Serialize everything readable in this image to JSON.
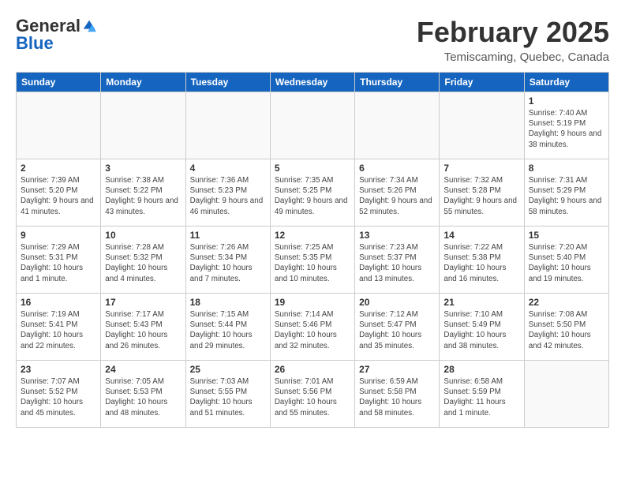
{
  "logo": {
    "general": "General",
    "blue": "Blue"
  },
  "header": {
    "month": "February 2025",
    "location": "Temiscaming, Quebec, Canada"
  },
  "weekdays": [
    "Sunday",
    "Monday",
    "Tuesday",
    "Wednesday",
    "Thursday",
    "Friday",
    "Saturday"
  ],
  "weeks": [
    [
      {
        "day": "",
        "info": ""
      },
      {
        "day": "",
        "info": ""
      },
      {
        "day": "",
        "info": ""
      },
      {
        "day": "",
        "info": ""
      },
      {
        "day": "",
        "info": ""
      },
      {
        "day": "",
        "info": ""
      },
      {
        "day": "1",
        "info": "Sunrise: 7:40 AM\nSunset: 5:19 PM\nDaylight: 9 hours and 38 minutes."
      }
    ],
    [
      {
        "day": "2",
        "info": "Sunrise: 7:39 AM\nSunset: 5:20 PM\nDaylight: 9 hours and 41 minutes."
      },
      {
        "day": "3",
        "info": "Sunrise: 7:38 AM\nSunset: 5:22 PM\nDaylight: 9 hours and 43 minutes."
      },
      {
        "day": "4",
        "info": "Sunrise: 7:36 AM\nSunset: 5:23 PM\nDaylight: 9 hours and 46 minutes."
      },
      {
        "day": "5",
        "info": "Sunrise: 7:35 AM\nSunset: 5:25 PM\nDaylight: 9 hours and 49 minutes."
      },
      {
        "day": "6",
        "info": "Sunrise: 7:34 AM\nSunset: 5:26 PM\nDaylight: 9 hours and 52 minutes."
      },
      {
        "day": "7",
        "info": "Sunrise: 7:32 AM\nSunset: 5:28 PM\nDaylight: 9 hours and 55 minutes."
      },
      {
        "day": "8",
        "info": "Sunrise: 7:31 AM\nSunset: 5:29 PM\nDaylight: 9 hours and 58 minutes."
      }
    ],
    [
      {
        "day": "9",
        "info": "Sunrise: 7:29 AM\nSunset: 5:31 PM\nDaylight: 10 hours and 1 minute."
      },
      {
        "day": "10",
        "info": "Sunrise: 7:28 AM\nSunset: 5:32 PM\nDaylight: 10 hours and 4 minutes."
      },
      {
        "day": "11",
        "info": "Sunrise: 7:26 AM\nSunset: 5:34 PM\nDaylight: 10 hours and 7 minutes."
      },
      {
        "day": "12",
        "info": "Sunrise: 7:25 AM\nSunset: 5:35 PM\nDaylight: 10 hours and 10 minutes."
      },
      {
        "day": "13",
        "info": "Sunrise: 7:23 AM\nSunset: 5:37 PM\nDaylight: 10 hours and 13 minutes."
      },
      {
        "day": "14",
        "info": "Sunrise: 7:22 AM\nSunset: 5:38 PM\nDaylight: 10 hours and 16 minutes."
      },
      {
        "day": "15",
        "info": "Sunrise: 7:20 AM\nSunset: 5:40 PM\nDaylight: 10 hours and 19 minutes."
      }
    ],
    [
      {
        "day": "16",
        "info": "Sunrise: 7:19 AM\nSunset: 5:41 PM\nDaylight: 10 hours and 22 minutes."
      },
      {
        "day": "17",
        "info": "Sunrise: 7:17 AM\nSunset: 5:43 PM\nDaylight: 10 hours and 26 minutes."
      },
      {
        "day": "18",
        "info": "Sunrise: 7:15 AM\nSunset: 5:44 PM\nDaylight: 10 hours and 29 minutes."
      },
      {
        "day": "19",
        "info": "Sunrise: 7:14 AM\nSunset: 5:46 PM\nDaylight: 10 hours and 32 minutes."
      },
      {
        "day": "20",
        "info": "Sunrise: 7:12 AM\nSunset: 5:47 PM\nDaylight: 10 hours and 35 minutes."
      },
      {
        "day": "21",
        "info": "Sunrise: 7:10 AM\nSunset: 5:49 PM\nDaylight: 10 hours and 38 minutes."
      },
      {
        "day": "22",
        "info": "Sunrise: 7:08 AM\nSunset: 5:50 PM\nDaylight: 10 hours and 42 minutes."
      }
    ],
    [
      {
        "day": "23",
        "info": "Sunrise: 7:07 AM\nSunset: 5:52 PM\nDaylight: 10 hours and 45 minutes."
      },
      {
        "day": "24",
        "info": "Sunrise: 7:05 AM\nSunset: 5:53 PM\nDaylight: 10 hours and 48 minutes."
      },
      {
        "day": "25",
        "info": "Sunrise: 7:03 AM\nSunset: 5:55 PM\nDaylight: 10 hours and 51 minutes."
      },
      {
        "day": "26",
        "info": "Sunrise: 7:01 AM\nSunset: 5:56 PM\nDaylight: 10 hours and 55 minutes."
      },
      {
        "day": "27",
        "info": "Sunrise: 6:59 AM\nSunset: 5:58 PM\nDaylight: 10 hours and 58 minutes."
      },
      {
        "day": "28",
        "info": "Sunrise: 6:58 AM\nSunset: 5:59 PM\nDaylight: 11 hours and 1 minute."
      },
      {
        "day": "",
        "info": ""
      }
    ]
  ]
}
